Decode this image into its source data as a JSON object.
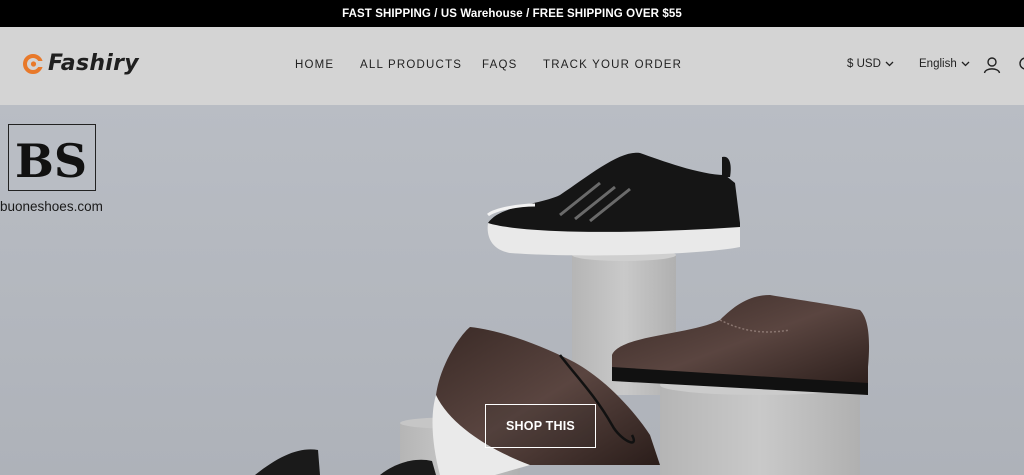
{
  "announcement": "FAST SHIPPING / US Warehouse / FREE SHIPPING OVER $55",
  "brand": {
    "name": "Fashiry",
    "accent_color": "#e8792a"
  },
  "nav": {
    "items": [
      "HOME",
      "ALL PRODUCTS",
      "FAQS",
      "TRACK YOUR ORDER"
    ]
  },
  "utilities": {
    "currency": "$ USD",
    "language": "English",
    "account_icon": "user-icon",
    "search_icon": "search-icon"
  },
  "hero": {
    "watermark_logo": "BS",
    "watermark_url": "buoneshoes.com",
    "cta_label": "SHOP THIS",
    "background_color": "#b4b8bf"
  }
}
